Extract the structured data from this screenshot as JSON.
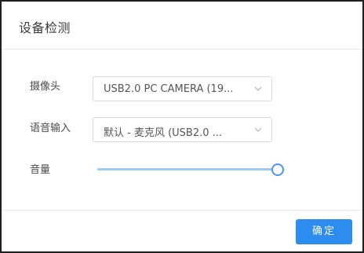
{
  "dialog": {
    "title": "设备检测",
    "camera": {
      "label": "摄像头",
      "selected": "USB2.0 PC CAMERA (19..."
    },
    "microphone": {
      "label": "语音输入",
      "selected": "默认 - 麦克风 (USB2.0 ..."
    },
    "volume": {
      "label": "音量",
      "level": 1.0
    },
    "ok_label": "确定"
  },
  "colors": {
    "primary": "#2d8cf0",
    "slider_track": "#9ccaf5",
    "slider_thumb_border": "#4a97e8"
  },
  "icons": {
    "select_arrow": "chevron-down-icon"
  }
}
